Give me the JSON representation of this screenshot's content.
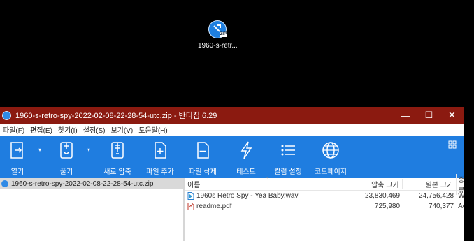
{
  "desktop": {
    "icon_label": "1960-s-retr...",
    "icon_badge": "ZIP"
  },
  "window": {
    "title": "1960-s-retro-spy-2022-02-08-22-28-54-utc.zip - 반디집 6.29",
    "controls": {
      "minimize": "—",
      "maximize": "☐",
      "close": "✕"
    }
  },
  "menu": [
    "파일(F)",
    "편집(E)",
    "찾기(I)",
    "설정(S)",
    "보기(V)",
    "도움말(H)"
  ],
  "toolbar": {
    "open": "열기",
    "extract": "풀기",
    "new_archive": "새로 압축",
    "add_file": "파일 추가",
    "delete_file": "파일 삭제",
    "test": "테스트",
    "column_settings": "칼럼 설정",
    "codepage": "코드페이지"
  },
  "tree": {
    "archive": "1960-s-retro-spy-2022-02-08-22-28-54-utc.zip"
  },
  "columns": {
    "name": "이름",
    "compressed": "압축 크기",
    "original": "원본 크기",
    "type": "종류"
  },
  "files": [
    {
      "name": "1960s Retro Spy - Yea Baby.wav",
      "compressed": "23,830,469",
      "original": "24,756,428",
      "type": "W"
    },
    {
      "name": "readme.pdf",
      "compressed": "725,980",
      "original": "740,377",
      "type": "Ac"
    }
  ],
  "colors": {
    "titlebar": "#8b1a10",
    "toolbar": "#1f7de0"
  }
}
